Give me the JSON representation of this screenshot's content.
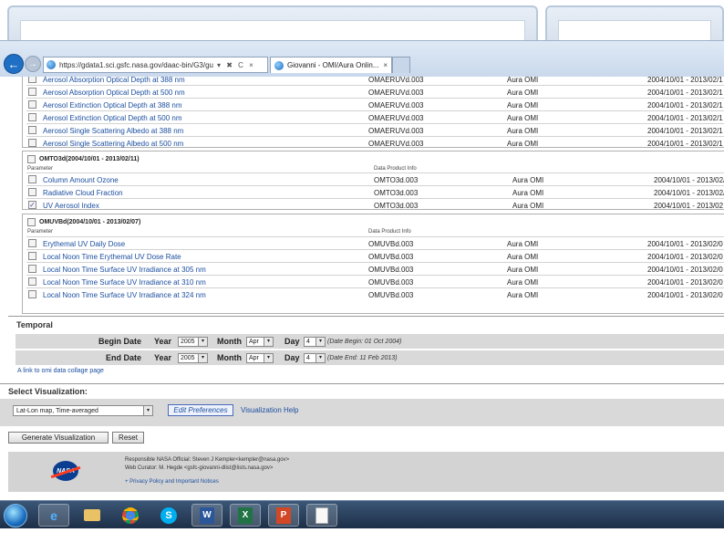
{
  "browser": {
    "address": "https://gdata1.sci.gsfc.nasa.gov/daac-bin/G3/gu",
    "address_controls": "▾ ✖ C ×",
    "active_tab_title": "Giovanni - OMI/Aura Onlin...",
    "tab_close": "×"
  },
  "omaeruv_rows": [
    {
      "param": "Aerosol Absorption Optical Depth at 388 nm",
      "prod": "OMAERUVd.003",
      "inst": "Aura OMI",
      "range": "2004/10/01 - 2013/02/1"
    },
    {
      "param": "Aerosol Absorption Optical Depth at 500 nm",
      "prod": "OMAERUVd.003",
      "inst": "Aura OMI",
      "range": "2004/10/01 - 2013/02/1"
    },
    {
      "param": "Aerosol Extinction Optical Depth at 388 nm",
      "prod": "OMAERUVd.003",
      "inst": "Aura OMI",
      "range": "2004/10/01 - 2013/02/1"
    },
    {
      "param": "Aerosol Extinction Optical Depth at 500 nm",
      "prod": "OMAERUVd.003",
      "inst": "Aura OMI",
      "range": "2004/10/01 - 2013/02/1"
    },
    {
      "param": "Aerosol Single Scattering Albedo at 388 nm",
      "prod": "OMAERUVd.003",
      "inst": "Aura OMI",
      "range": "2004/10/01 - 2013/02/1"
    },
    {
      "param": "Aerosol Single Scattering Albedo at 500 nm",
      "prod": "OMAERUVd.003",
      "inst": "Aura OMI",
      "range": "2004/10/01 - 2013/02/1"
    }
  ],
  "omto3d": {
    "title": "OMTO3d(2004/10/01 - 2013/02/11)",
    "col_param": "Parameter",
    "col_prod": "Data Product Info",
    "rows": [
      {
        "param": "Column Amount Ozone",
        "prod": "OMTO3d.003",
        "inst": "Aura OMI",
        "range": "2004/10/01 - 2013/02/",
        "checked": ""
      },
      {
        "param": "Radiative Cloud Fraction",
        "prod": "OMTO3d.003",
        "inst": "Aura OMI",
        "range": "2004/10/01 - 2013/02/",
        "checked": ""
      },
      {
        "param": "UV Aerosol Index",
        "prod": "OMTO3d.003",
        "inst": "Aura OMI",
        "range": "2004/10/01 - 2013/02",
        "checked": "✓"
      }
    ]
  },
  "omuvbd": {
    "title": "OMUVBd(2004/10/01 - 2013/02/07)",
    "col_param": "Parameter",
    "col_prod": "Data Product Info",
    "rows": [
      {
        "param": "Erythemal UV Daily Dose",
        "prod": "OMUVBd.003",
        "inst": "Aura OMI",
        "range": "2004/10/01 - 2013/02/0"
      },
      {
        "param": "Local Noon Time Erythemal UV Dose Rate",
        "prod": "OMUVBd.003",
        "inst": "Aura OMI",
        "range": "2004/10/01 - 2013/02/0"
      },
      {
        "param": "Local Noon Time Surface UV Irradiance at 305 nm",
        "prod": "OMUVBd.003",
        "inst": "Aura OMI",
        "range": "2004/10/01 - 2013/02/0"
      },
      {
        "param": "Local Noon Time Surface UV Irradiance at 310 nm",
        "prod": "OMUVBd.003",
        "inst": "Aura OMI",
        "range": "2004/10/01 - 2013/02/0"
      },
      {
        "param": "Local Noon Time Surface UV Irradiance at 324 nm",
        "prod": "OMUVBd.003",
        "inst": "Aura OMI",
        "range": "2004/10/01 - 2013/02/0"
      }
    ]
  },
  "temporal": {
    "title": "Temporal",
    "begin_label": "Begin Date",
    "end_label": "End Date",
    "year_label": "Year",
    "month_label": "Month",
    "day_label": "Day",
    "begin_year": "2005",
    "begin_month": "Apr",
    "begin_day": "4",
    "end_year": "2005",
    "end_month": "Apr",
    "end_day": "4",
    "begin_hint": "(Date Begin: 01 Oct 2004)",
    "end_hint": "(Date End: 11 Feb 2013)",
    "collage_link": "A link to omi data collage page"
  },
  "visualization": {
    "title": "Select Visualization:",
    "selected": "Lat-Lon map, Time-averaged",
    "edit_prefs": "Edit Preferences",
    "help_link": "Visualization Help",
    "generate_btn": "Generate Visualization",
    "reset_btn": "Reset"
  },
  "footer": {
    "logo_text": "NASA",
    "official": "Responsible NASA Official: Steven J Kempler<kempler@nasa.gov>",
    "curator": "Web Curator: M. Hegde <gsfc-giovanni-dlist@lists.nasa.gov>",
    "privacy": "+ Privacy Policy and Important Notices"
  },
  "taskbar_icons": [
    "ie-icon",
    "folder-icon",
    "chrome-icon",
    "skype-icon",
    "word-icon",
    "excel-icon",
    "powerpoint-icon",
    "document-icon"
  ]
}
